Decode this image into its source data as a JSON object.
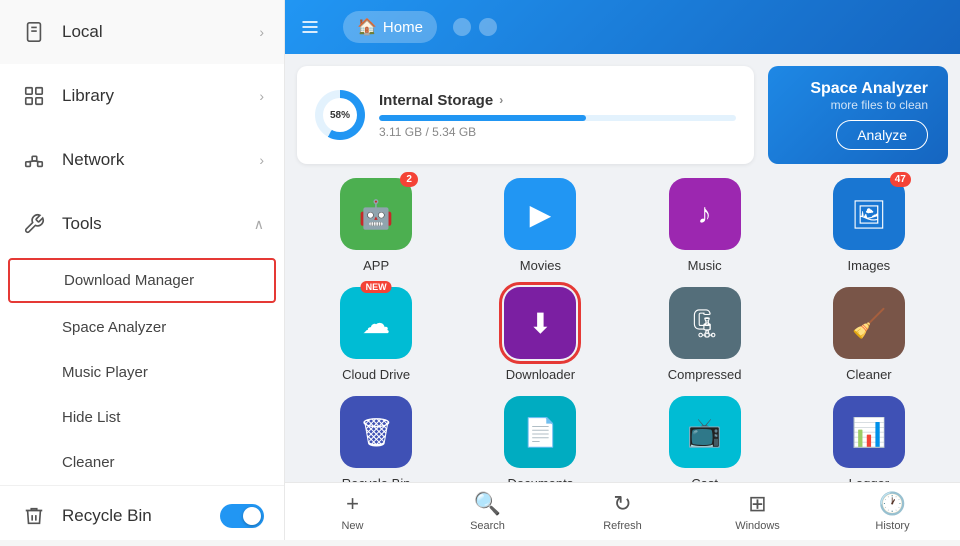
{
  "sidebar": {
    "items": [
      {
        "id": "local",
        "label": "Local",
        "icon": "📱",
        "hasChevron": true
      },
      {
        "id": "library",
        "label": "Library",
        "icon": "📚",
        "hasChevron": true
      },
      {
        "id": "network",
        "label": "Network",
        "icon": "🖨️",
        "hasChevron": true
      }
    ],
    "tools": {
      "label": "Tools",
      "icon": "🔧",
      "subitems": [
        {
          "id": "download-manager",
          "label": "Download Manager",
          "highlighted": true
        },
        {
          "id": "space-analyzer",
          "label": "Space Analyzer",
          "highlighted": false
        },
        {
          "id": "music-player",
          "label": "Music Player",
          "highlighted": false
        },
        {
          "id": "hide-list",
          "label": "Hide List",
          "highlighted": false
        },
        {
          "id": "cleaner",
          "label": "Cleaner",
          "highlighted": false
        }
      ]
    },
    "recycle_bin": {
      "label": "Recycle Bin",
      "icon": "🗑️"
    }
  },
  "header": {
    "home_label": "Home",
    "hamburger_label": "☰"
  },
  "storage": {
    "label": "Internal Storage",
    "percent": 58,
    "used": "3.11 GB",
    "total": "5.34 GB",
    "bar_width": "58%"
  },
  "space_analyzer": {
    "title": "Space Analyzer",
    "subtitle": "more files to clean",
    "button_label": "Analyze"
  },
  "grid_items": [
    {
      "id": "app",
      "label": "APP",
      "icon": "🤖",
      "color": "bg-green",
      "badge": "2",
      "badge_type": "number"
    },
    {
      "id": "movies",
      "label": "Movies",
      "icon": "▶",
      "color": "bg-blue",
      "badge": null
    },
    {
      "id": "music",
      "label": "Music",
      "icon": "♪",
      "color": "bg-purple",
      "badge": null
    },
    {
      "id": "images",
      "label": "Images",
      "icon": "🖼",
      "color": "bg-blue2",
      "badge": "47",
      "badge_type": "number"
    },
    {
      "id": "cloud-drive",
      "label": "Cloud Drive",
      "icon": "☁",
      "color": "bg-teal",
      "badge": "NEW",
      "badge_type": "new"
    },
    {
      "id": "downloader",
      "label": "Downloader",
      "icon": "⬇",
      "color": "bg-purple2",
      "badge": null,
      "selected": true
    },
    {
      "id": "compressed",
      "label": "Compressed",
      "icon": "🗜",
      "color": "bg-slate",
      "badge": null
    },
    {
      "id": "cleaner",
      "label": "Cleaner",
      "icon": "🧹",
      "color": "bg-brown",
      "badge": null
    },
    {
      "id": "recycle-bin",
      "label": "Recycle Bin",
      "icon": "🗑",
      "color": "bg-indigo",
      "badge": null
    },
    {
      "id": "documents",
      "label": "Documents",
      "icon": "📄",
      "color": "bg-cyan",
      "badge": null
    },
    {
      "id": "cast",
      "label": "Cast",
      "icon": "📺",
      "color": "bg-teal",
      "badge": null
    },
    {
      "id": "logger",
      "label": "Logger",
      "icon": "📊",
      "color": "bg-indigo",
      "badge": null
    }
  ],
  "toolbar": {
    "items": [
      {
        "id": "new",
        "icon": "+",
        "label": "New"
      },
      {
        "id": "search",
        "icon": "🔍",
        "label": "Search"
      },
      {
        "id": "refresh",
        "icon": "↻",
        "label": "Refresh"
      },
      {
        "id": "windows",
        "icon": "⊞",
        "label": "Windows"
      },
      {
        "id": "history",
        "icon": "🕐",
        "label": "History"
      }
    ]
  }
}
